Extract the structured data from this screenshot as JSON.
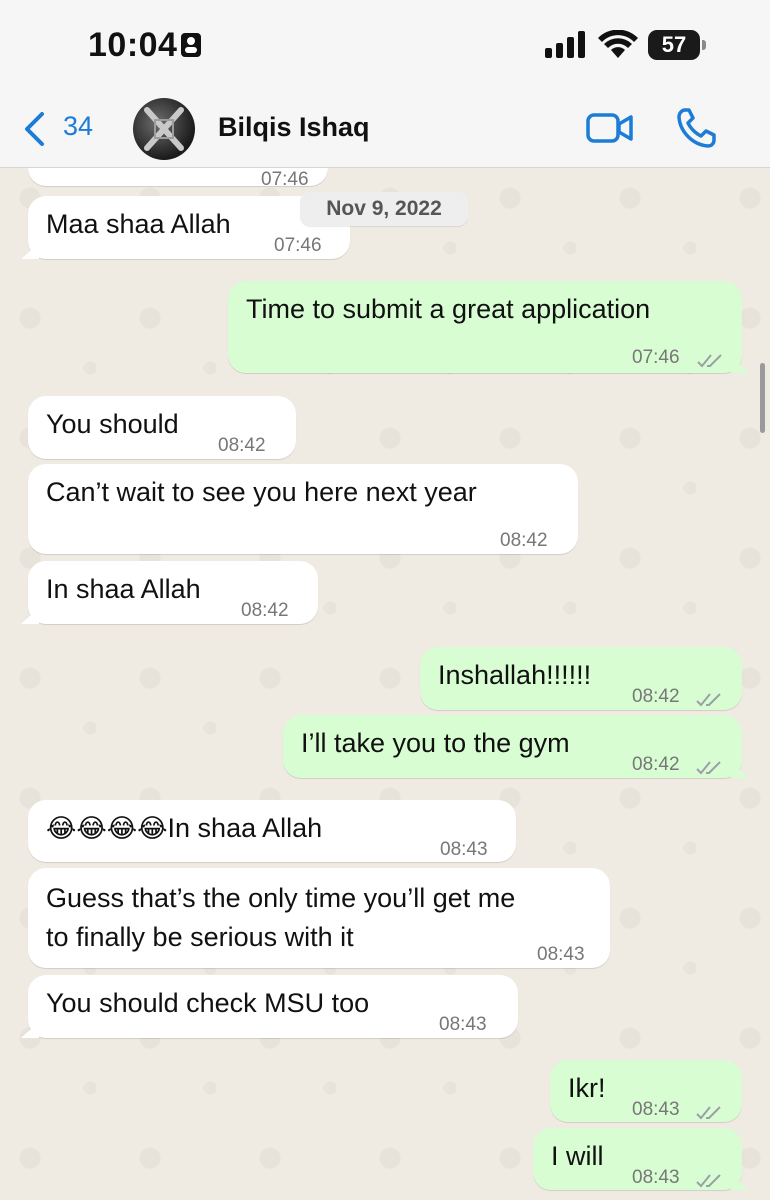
{
  "status_bar": {
    "time": "10:04",
    "battery": "57"
  },
  "header": {
    "back_count": "34",
    "contact_name": "Bilqis Ishaq"
  },
  "date_chip": "Nov 9, 2022",
  "messages": [
    {
      "direction": "in",
      "text": "Maa shaa Allah",
      "time": "07:46"
    },
    {
      "direction": "out",
      "text": "Time to submit a great application",
      "time": "07:46"
    },
    {
      "direction": "in",
      "text": "You should",
      "time": "08:42"
    },
    {
      "direction": "in",
      "text": "Can’t wait to see you here next year",
      "time": "08:42"
    },
    {
      "direction": "in",
      "text": "In shaa Allah",
      "time": "08:42"
    },
    {
      "direction": "out",
      "text": "Inshallah!!!!!!",
      "time": "08:42"
    },
    {
      "direction": "out",
      "text": "I’ll take you to the gym",
      "time": "08:42"
    },
    {
      "direction": "in",
      "emoji": "😂😂😂😂",
      "text": "In shaa Allah",
      "time": "08:43"
    },
    {
      "direction": "in",
      "text_line1": "Guess that’s the only time you’ll get me",
      "text_line2": "to finally be serious with it",
      "time": "08:43"
    },
    {
      "direction": "in",
      "text": "You should check MSU too",
      "time": "08:43"
    },
    {
      "direction": "out",
      "text": "Ikr!",
      "time": "08:43"
    },
    {
      "direction": "out",
      "text": "I will",
      "time": "08:43"
    }
  ],
  "partial_top_time": "07:46",
  "colors": {
    "accent": "#1c7cd6",
    "outgoing_bubble": "#d9fdd3",
    "incoming_bubble": "#ffffff",
    "chat_background": "#efeae2",
    "read_ticks": "#9aa0a6"
  }
}
